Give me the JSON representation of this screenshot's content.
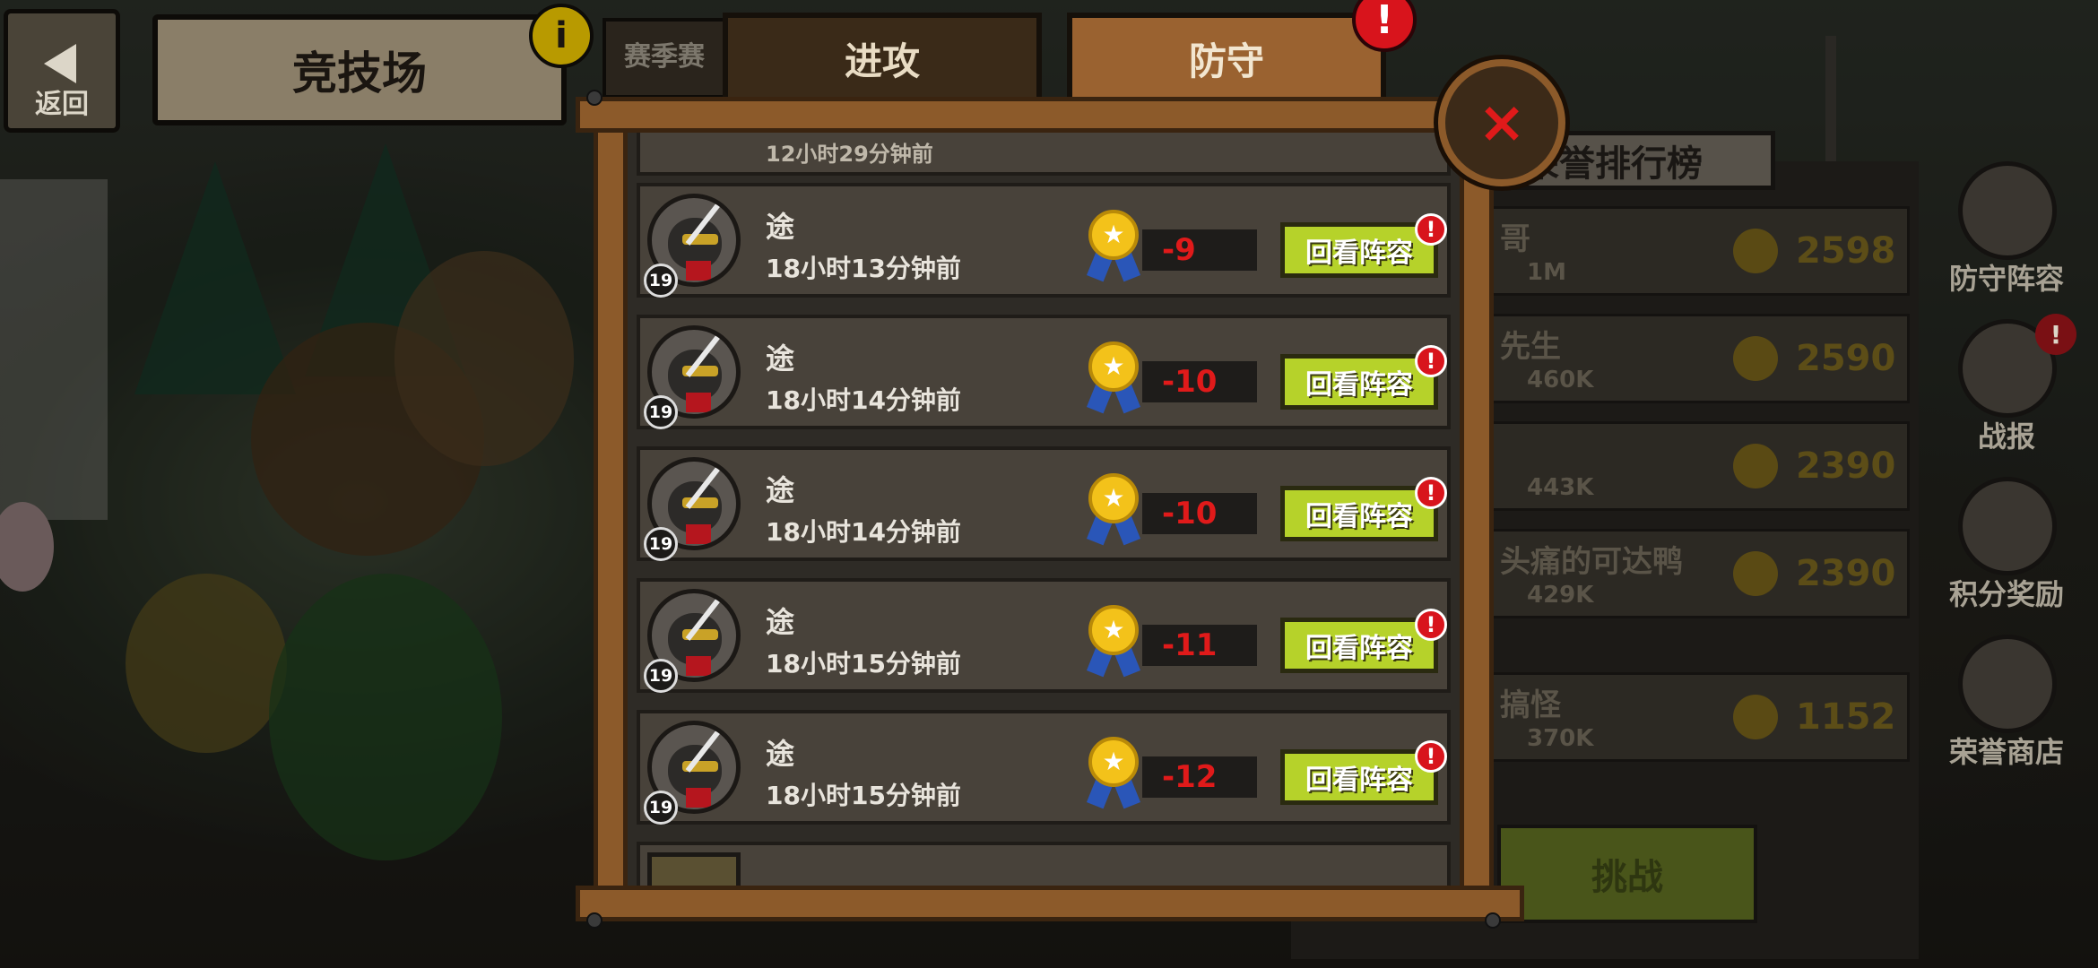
{
  "header": {
    "back_label": "返回",
    "title": "竞技场",
    "info_label": "i",
    "season_tab_label": "赛季赛"
  },
  "tabs": {
    "attack": "进攻",
    "defend": "防守",
    "defend_alert": "!"
  },
  "close_label": "×",
  "battle_log": {
    "partial_top_time": "12小时29分钟前",
    "entries": [
      {
        "name": "途",
        "level": "19",
        "time": "18小时13分钟前",
        "score_change": "-9",
        "replay_label": "回看阵容",
        "alert": "!"
      },
      {
        "name": "途",
        "level": "19",
        "time": "18小时14分钟前",
        "score_change": "-10",
        "replay_label": "回看阵容",
        "alert": "!"
      },
      {
        "name": "途",
        "level": "19",
        "time": "18小时14分钟前",
        "score_change": "-10",
        "replay_label": "回看阵容",
        "alert": "!"
      },
      {
        "name": "途",
        "level": "19",
        "time": "18小时15分钟前",
        "score_change": "-11",
        "replay_label": "回看阵容",
        "alert": "!"
      },
      {
        "name": "途",
        "level": "19",
        "time": "18小时15分钟前",
        "score_change": "-12",
        "replay_label": "回看阵容",
        "alert": "!"
      }
    ]
  },
  "ranking": {
    "title": "荣誉排行榜",
    "rows": [
      {
        "name": "哥",
        "power": "1M",
        "score": "2598"
      },
      {
        "name": "先生",
        "power": "460K",
        "score": "2590"
      },
      {
        "name": "",
        "power": "443K",
        "score": "2390"
      },
      {
        "name": "头痛的可达鸭",
        "power": "429K",
        "score": "2390"
      },
      {
        "name": "搞怪",
        "power": "370K",
        "score": "1152"
      }
    ],
    "challenge_label": "挑战"
  },
  "side_menu": [
    {
      "label": "防守阵容",
      "alert": ""
    },
    {
      "label": "战报",
      "alert": "!"
    },
    {
      "label": "积分奖励",
      "alert": ""
    },
    {
      "label": "荣誉商店",
      "alert": ""
    }
  ],
  "colors": {
    "tab_active": "#9a6230",
    "frame_wood": "#8c5a2a",
    "replay_button": "#b6d22a",
    "score_negative": "#e01a1a",
    "alert_red": "#d8141c"
  }
}
